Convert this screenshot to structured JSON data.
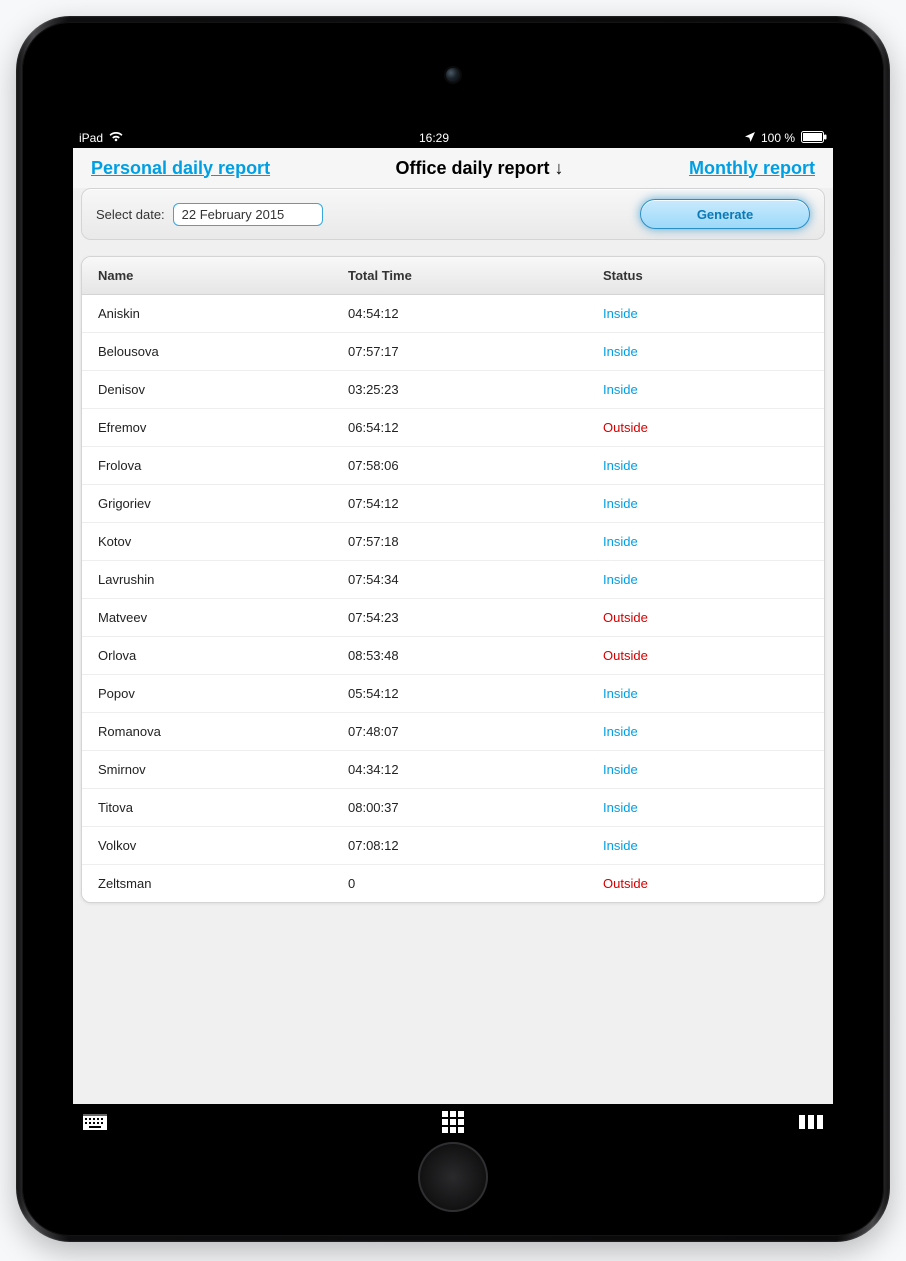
{
  "statusbar": {
    "device": "iPad",
    "time": "16:29",
    "battery": "100 %"
  },
  "nav": {
    "left": "Personal daily report",
    "title": "Office daily report ↓",
    "right": "Monthly report"
  },
  "toolbar": {
    "select_date_label": "Select date:",
    "date_value": "22 February 2015",
    "generate_label": "Generate"
  },
  "table": {
    "headers": {
      "name": "Name",
      "time": "Total Time",
      "status": "Status"
    },
    "rows": [
      {
        "name": "Aniskin",
        "time": "04:54:12",
        "status": "Inside"
      },
      {
        "name": "Belousova",
        "time": "07:57:17",
        "status": "Inside"
      },
      {
        "name": "Denisov",
        "time": "03:25:23",
        "status": "Inside"
      },
      {
        "name": "Efremov",
        "time": "06:54:12",
        "status": "Outside"
      },
      {
        "name": "Frolova",
        "time": "07:58:06",
        "status": "Inside"
      },
      {
        "name": "Grigoriev",
        "time": "07:54:12",
        "status": "Inside"
      },
      {
        "name": "Kotov",
        "time": "07:57:18",
        "status": "Inside"
      },
      {
        "name": "Lavrushin",
        "time": "07:54:34",
        "status": "Inside"
      },
      {
        "name": "Matveev",
        "time": "07:54:23",
        "status": "Outside"
      },
      {
        "name": "Orlova",
        "time": "08:53:48",
        "status": "Outside"
      },
      {
        "name": "Popov",
        "time": "05:54:12",
        "status": "Inside"
      },
      {
        "name": "Romanova",
        "time": "07:48:07",
        "status": "Inside"
      },
      {
        "name": "Smirnov",
        "time": "04:34:12",
        "status": "Inside"
      },
      {
        "name": "Titova",
        "time": "08:00:37",
        "status": "Inside"
      },
      {
        "name": "Volkov",
        "time": "07:08:12",
        "status": "Inside"
      },
      {
        "name": "Zeltsman",
        "time": "0",
        "status": "Outside"
      }
    ]
  }
}
